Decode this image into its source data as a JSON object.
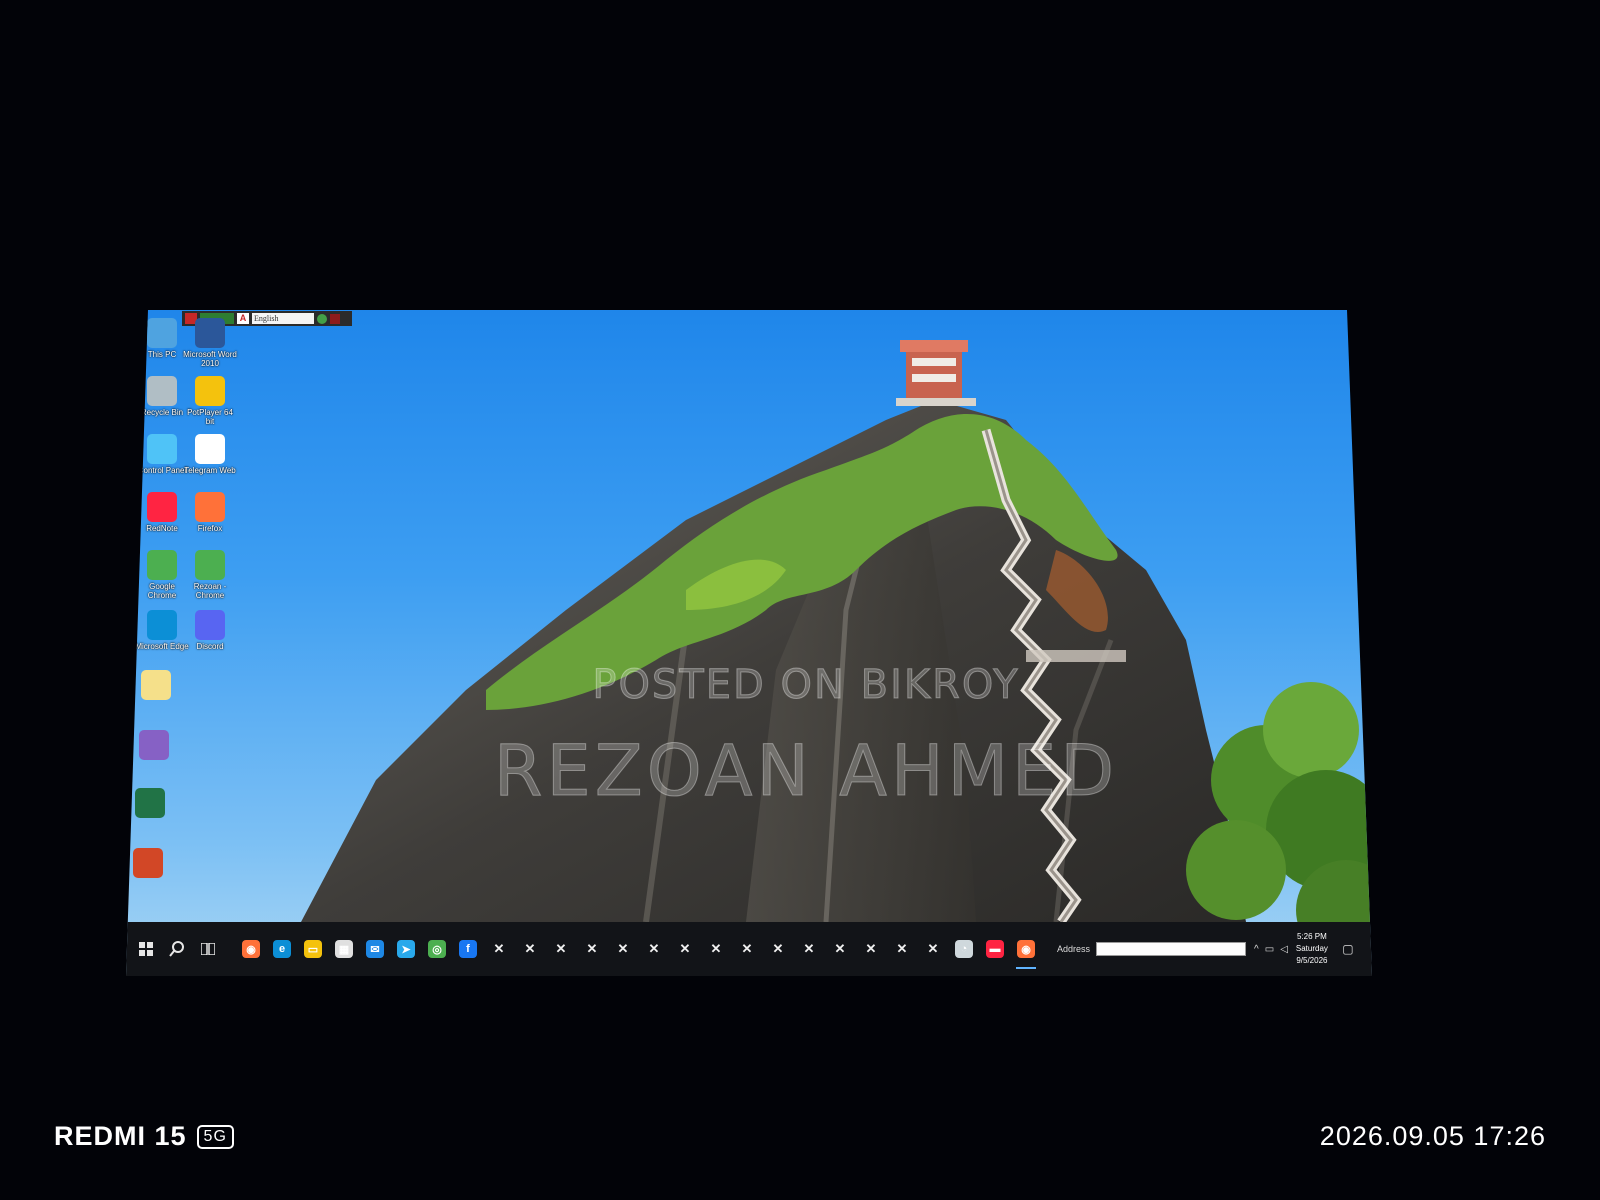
{
  "langbar": {
    "app_label": "A",
    "language": "English"
  },
  "desktop_icons": [
    {
      "label": "This PC",
      "icon": "monitor-icon",
      "color": "#4fa3e0"
    },
    {
      "label": "Microsoft Word 2010",
      "icon": "word-icon",
      "color": "#2b579a"
    },
    {
      "label": "Recycle Bin",
      "icon": "recycle-bin-icon",
      "color": "#b0bec5"
    },
    {
      "label": "PotPlayer 64 bit",
      "icon": "potplayer-icon",
      "color": "#f4c20d"
    },
    {
      "label": "Control Panel",
      "icon": "control-panel-icon",
      "color": "#4fc3f7"
    },
    {
      "label": "Telegram Web",
      "icon": "telegram-icon",
      "color": "#ffffff"
    },
    {
      "label": "RedNote",
      "icon": "rednote-icon",
      "color": "#ff2442"
    },
    {
      "label": "Firefox",
      "icon": "firefox-icon",
      "color": "#ff7139"
    },
    {
      "label": "Google Chrome",
      "icon": "chrome-icon",
      "color": "#4caf50"
    },
    {
      "label": "Rezoan - Chrome",
      "icon": "chrome-icon",
      "color": "#4caf50"
    },
    {
      "label": "Microsoft Edge",
      "icon": "edge-icon",
      "color": "#0c8fd6"
    },
    {
      "label": "Discord",
      "icon": "discord-icon",
      "color": "#5865f2"
    },
    {
      "label": "",
      "icon": "editor-icon",
      "color": "#f5e08a"
    },
    {
      "label": "",
      "icon": "visual-studio-icon",
      "color": "#8661c5"
    },
    {
      "label": "",
      "icon": "excel-icon",
      "color": "#217346"
    },
    {
      "label": "",
      "icon": "powerpoint-icon",
      "color": "#d24726"
    }
  ],
  "watermark": {
    "line1": "POSTED ON BIKROY",
    "line2": "REZOAN AHMED"
  },
  "taskbar": {
    "start_icon": "windows-start-icon",
    "search_icon": "search-icon",
    "taskview_icon": "task-view-icon",
    "pinned": [
      {
        "name": "firefox-icon",
        "color": "#ff7139",
        "glyph": "◉"
      },
      {
        "name": "edge-icon",
        "color": "#0c8fd6",
        "glyph": "e"
      },
      {
        "name": "file-explorer-icon",
        "color": "#f4c20d",
        "glyph": "▭"
      },
      {
        "name": "calendar-icon",
        "color": "#e0e0e0",
        "glyph": "▦"
      },
      {
        "name": "mail-icon",
        "color": "#1e88e5",
        "glyph": "✉"
      },
      {
        "name": "telegram-icon",
        "color": "#29a9eb",
        "glyph": "➤"
      },
      {
        "name": "chrome-icon",
        "color": "#4caf50",
        "glyph": "◎"
      },
      {
        "name": "facebook-icon",
        "color": "#1877f2",
        "glyph": "f"
      }
    ],
    "open_window_glyph": "✕",
    "open_window_count": 15,
    "trailing": [
      {
        "name": "speedometer-icon",
        "color": "#cfd8dc",
        "glyph": "◔"
      },
      {
        "name": "rednote-icon",
        "color": "#ff2442",
        "glyph": "▬"
      },
      {
        "name": "firefox-icon",
        "color": "#ff7139",
        "glyph": "◉"
      }
    ],
    "address_label": "Address",
    "address_value": "",
    "clock": {
      "time": "5:26 PM",
      "day": "Saturday",
      "date": "9/5/2026"
    }
  },
  "photo_overlay": {
    "brand": "REDMI 15",
    "network": "5G",
    "timestamp": "2026.09.05 17:26"
  }
}
